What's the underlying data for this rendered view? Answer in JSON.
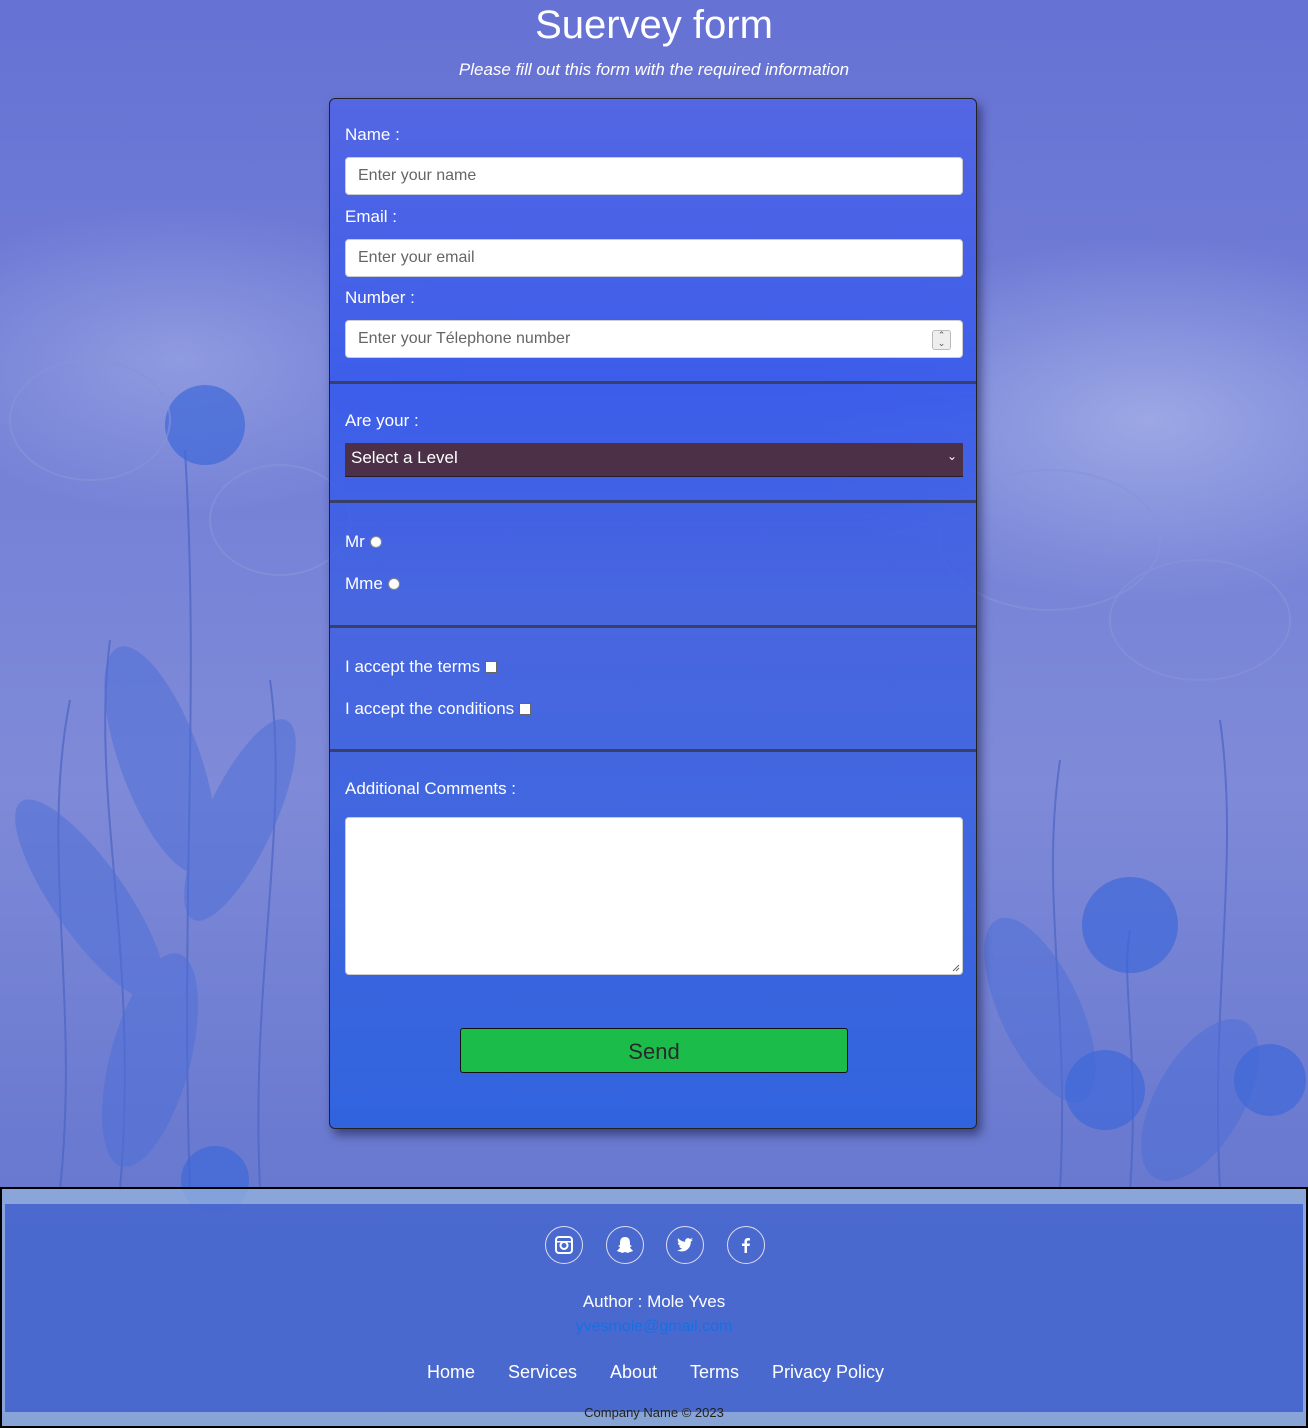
{
  "header": {
    "title": "Suervey form",
    "subtitle": "Please fill out this form with the required information"
  },
  "form": {
    "name_label": "Name :",
    "name_placeholder": "Enter your name",
    "email_label": "Email :",
    "email_placeholder": "Enter your email",
    "number_label": "Number :",
    "number_placeholder": "Enter your Télephone number",
    "level_label": "Are your :",
    "level_selected": "Select a Level",
    "radio_options": [
      "Mr",
      "Mme"
    ],
    "checkbox_options": [
      "I accept the terms",
      "I accept the conditions"
    ],
    "comments_label": "Additional Comments :",
    "send_label": "Send"
  },
  "footer": {
    "social_icons": [
      "instagram-icon",
      "snapchat-icon",
      "twitter-icon",
      "facebook-icon"
    ],
    "author": "Author : Mole Yves",
    "email": "yvesmole@gmail.com",
    "nav": [
      "Home",
      "Services",
      "About",
      "Terms",
      "Privacy Policy"
    ],
    "copyright": "Company Name © 2023"
  },
  "colors": {
    "send_button": "#1cbc4b",
    "select_background": "#4b3047",
    "email_link": "#1a6fe0"
  }
}
